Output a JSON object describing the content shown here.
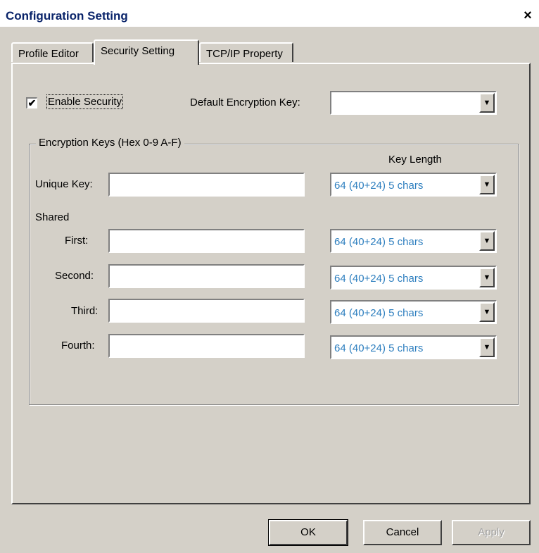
{
  "window": {
    "title": "Configuration Setting",
    "close_glyph": "×"
  },
  "tabs": [
    {
      "label": "Profile Editor",
      "active": false
    },
    {
      "label": "Security Setting",
      "active": true
    },
    {
      "label": "TCP/IP Property",
      "active": false
    }
  ],
  "security": {
    "enable_label": "Enable Security",
    "enable_checked": true,
    "check_glyph": "✔",
    "default_key_label": "Default Encryption Key:",
    "default_key_value": ""
  },
  "keys_group": {
    "title": "Encryption Keys (Hex 0-9 A-F)",
    "key_length_header": "Key Length",
    "unique": {
      "label": "Unique Key:",
      "value": "",
      "length": "64  (40+24)  5 chars"
    },
    "shared_label": "Shared",
    "shared": [
      {
        "label": "First:",
        "value": "",
        "length": "64  (40+24)  5 chars"
      },
      {
        "label": "Second:",
        "value": "",
        "length": "64  (40+24)  5 chars"
      },
      {
        "label": "Third:",
        "value": "",
        "length": "64  (40+24)  5 chars"
      },
      {
        "label": "Fourth:",
        "value": "",
        "length": "64  (40+24)  5 chars"
      }
    ]
  },
  "buttons": {
    "ok": "OK",
    "cancel": "Cancel",
    "apply": "Apply"
  },
  "icons": {
    "dropdown_arrow": "▼"
  },
  "colors": {
    "dialog_bg": "#d4d0c8",
    "combo_text": "#2e7fbf",
    "title_text": "#0a246a"
  }
}
